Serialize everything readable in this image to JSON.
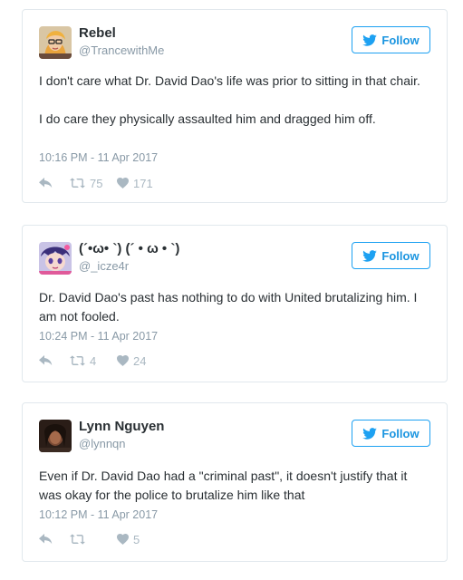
{
  "colors": {
    "accent": "#1da1f2",
    "muted": "#8899a6",
    "icon": "#aab8c2",
    "border": "#e1e8ed",
    "text": "#292f33"
  },
  "tweets": [
    {
      "name": "Rebel",
      "handle": "@TrancewithMe",
      "follow_label": "Follow",
      "paragraphs": [
        "I don't care what Dr. David Dao's life was prior to sitting in that chair.",
        "I do care they physically assaulted him and dragged him off."
      ],
      "time": "10:16 PM - 11 Apr 2017",
      "retweets": "75",
      "likes": "171",
      "avatar_icon": "woman-glasses-avatar"
    },
    {
      "name": "(´•ω• `) (´ • ω •  `)",
      "handle": "@_icze4r",
      "follow_label": "Follow",
      "paragraphs": [
        "Dr. David Dao's past has nothing to do with United brutalizing him. I am not fooled."
      ],
      "time": "10:24 PM - 11 Apr 2017",
      "retweets": "4",
      "likes": "24",
      "avatar_icon": "anime-character-avatar"
    },
    {
      "name": "Lynn Nguyen",
      "handle": "@lynnqn",
      "follow_label": "Follow",
      "paragraphs": [
        "Even if Dr. David Dao had a \"criminal past\", it doesn't justify that it was okay for the police to brutalize him like that"
      ],
      "time": "10:12 PM - 11 Apr 2017",
      "retweets": "",
      "likes": "5",
      "avatar_icon": "dark-portrait-avatar"
    }
  ]
}
